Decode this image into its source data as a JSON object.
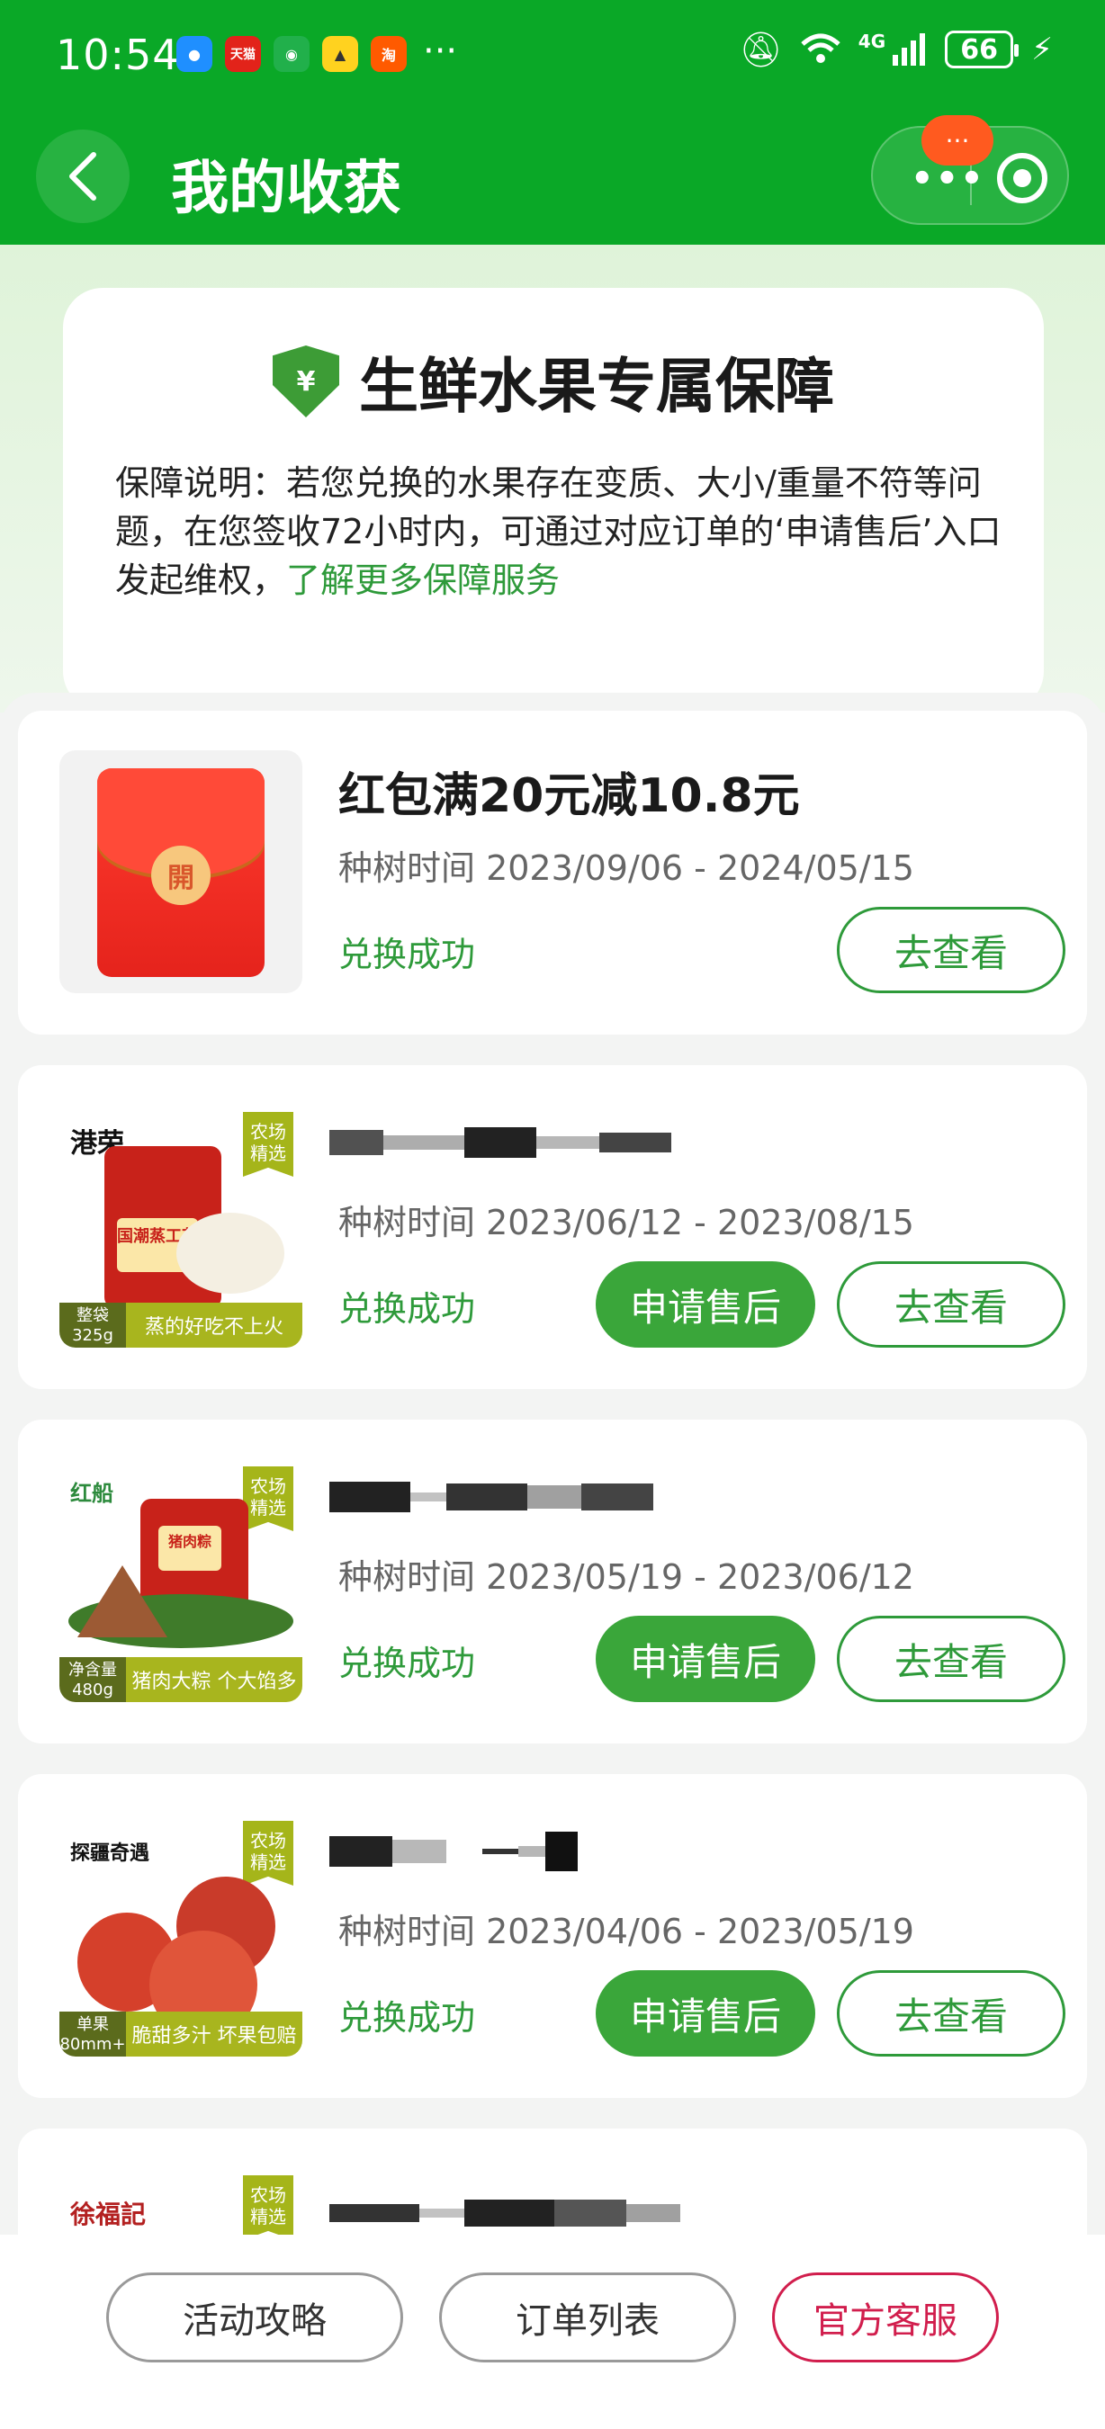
{
  "status_bar": {
    "time": "10:54",
    "apps": [
      "eleme-icon",
      "tmall-icon",
      "wechat-icon",
      "yellow-app-icon",
      "taobao-icon"
    ],
    "tmall_label": "天猫",
    "taobao_label": "淘",
    "more": "···",
    "network": "4G",
    "battery": "66"
  },
  "nav": {
    "title": "我的收获",
    "capsule_badge": "···"
  },
  "guarantee": {
    "shield_symbol": "¥",
    "title": "生鲜水果专属保障",
    "description": "保障说明：若您兑换的水果存在变质、大小/重量不符等问题，在您签收72小时内，可通过对应订单的‘申请售后’入口发起维权，",
    "link": "了解更多保障服务"
  },
  "items": [
    {
      "title": "红包满20元减10.8元",
      "time": "种树时间 2023/09/06 - 2024/05/15",
      "status": "兑换成功",
      "view_label": "去查看",
      "seal": "開"
    },
    {
      "time": "种树时间 2023/06/12 - 2023/08/15",
      "status": "兑换成功",
      "aftersale_label": "申请售后",
      "view_label": "去查看",
      "brand": "港荣",
      "farm_badge": "农场精选",
      "footer_left": "整袋 325g",
      "footer_right": "蒸的好吃不上火",
      "package_text": "国潮蒸工艺"
    },
    {
      "time": "种树时间 2023/05/19 - 2023/06/12",
      "status": "兑换成功",
      "aftersale_label": "申请售后",
      "view_label": "去查看",
      "brand": "红船",
      "farm_badge": "农场精选",
      "footer_left": "净含量 480g",
      "footer_right": "猪肉大粽 个大馅多",
      "package_text": "猪肉粽"
    },
    {
      "time": "种树时间 2023/04/06 - 2023/05/19",
      "status": "兑换成功",
      "aftersale_label": "申请售后",
      "view_label": "去查看",
      "brand": "探疆奇遇",
      "farm_badge": "农场精选",
      "footer_left": "单果 80mm+",
      "footer_right": "脆甜多汁 坏果包赔"
    },
    {
      "brand": "徐福記",
      "farm_badge": "农场精选"
    }
  ],
  "bottom": {
    "strategy": "活动攻略",
    "orders": "订单列表",
    "service": "官方客服"
  },
  "colors": {
    "brand_green": "#0aa827",
    "accent_green": "#2e9a3a",
    "service_red": "#d11e4d"
  }
}
